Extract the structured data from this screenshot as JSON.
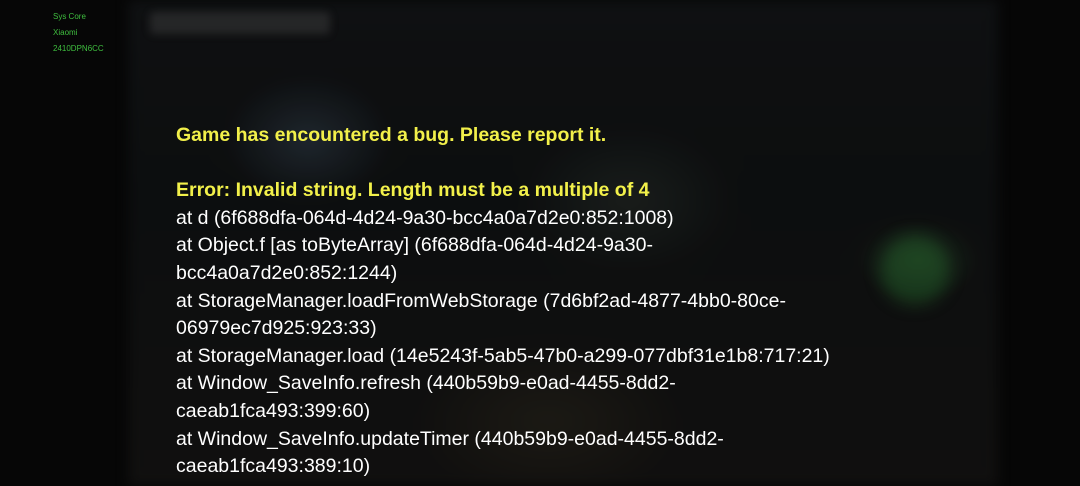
{
  "device": {
    "line1": "Sys Core",
    "line2": "Xiaomi",
    "line3": "2410DPN6CC"
  },
  "error": {
    "headline": "Game has encountered a bug. Please report it.",
    "message": "Error: Invalid string. Length must be a multiple of 4",
    "stack": [
      "at d (6f688dfa-064d-4d24-9a30-bcc4a0a7d2e0:852:1008)",
      "at Object.f [as toByteArray] (6f688dfa-064d-4d24-9a30-",
      "bcc4a0a7d2e0:852:1244)",
      "at StorageManager.loadFromWebStorage (7d6bf2ad-4877-4bb0-80ce-",
      "06979ec7d925:923:33)",
      "at StorageManager.load (14e5243f-5ab5-47b0-a299-077dbf31e1b8:717:21)",
      "at Window_SaveInfo.refresh (440b59b9-e0ad-4455-8dd2-",
      "caeab1fca493:399:60)",
      "at Window_SaveInfo.updateTimer (440b59b9-e0ad-4455-8dd2-",
      "caeab1fca493:389:10)"
    ]
  },
  "colors": {
    "headline": "#f2f04a",
    "device_text": "#3fbf3f",
    "stack_text": "#ffffff",
    "background": "#060606"
  }
}
